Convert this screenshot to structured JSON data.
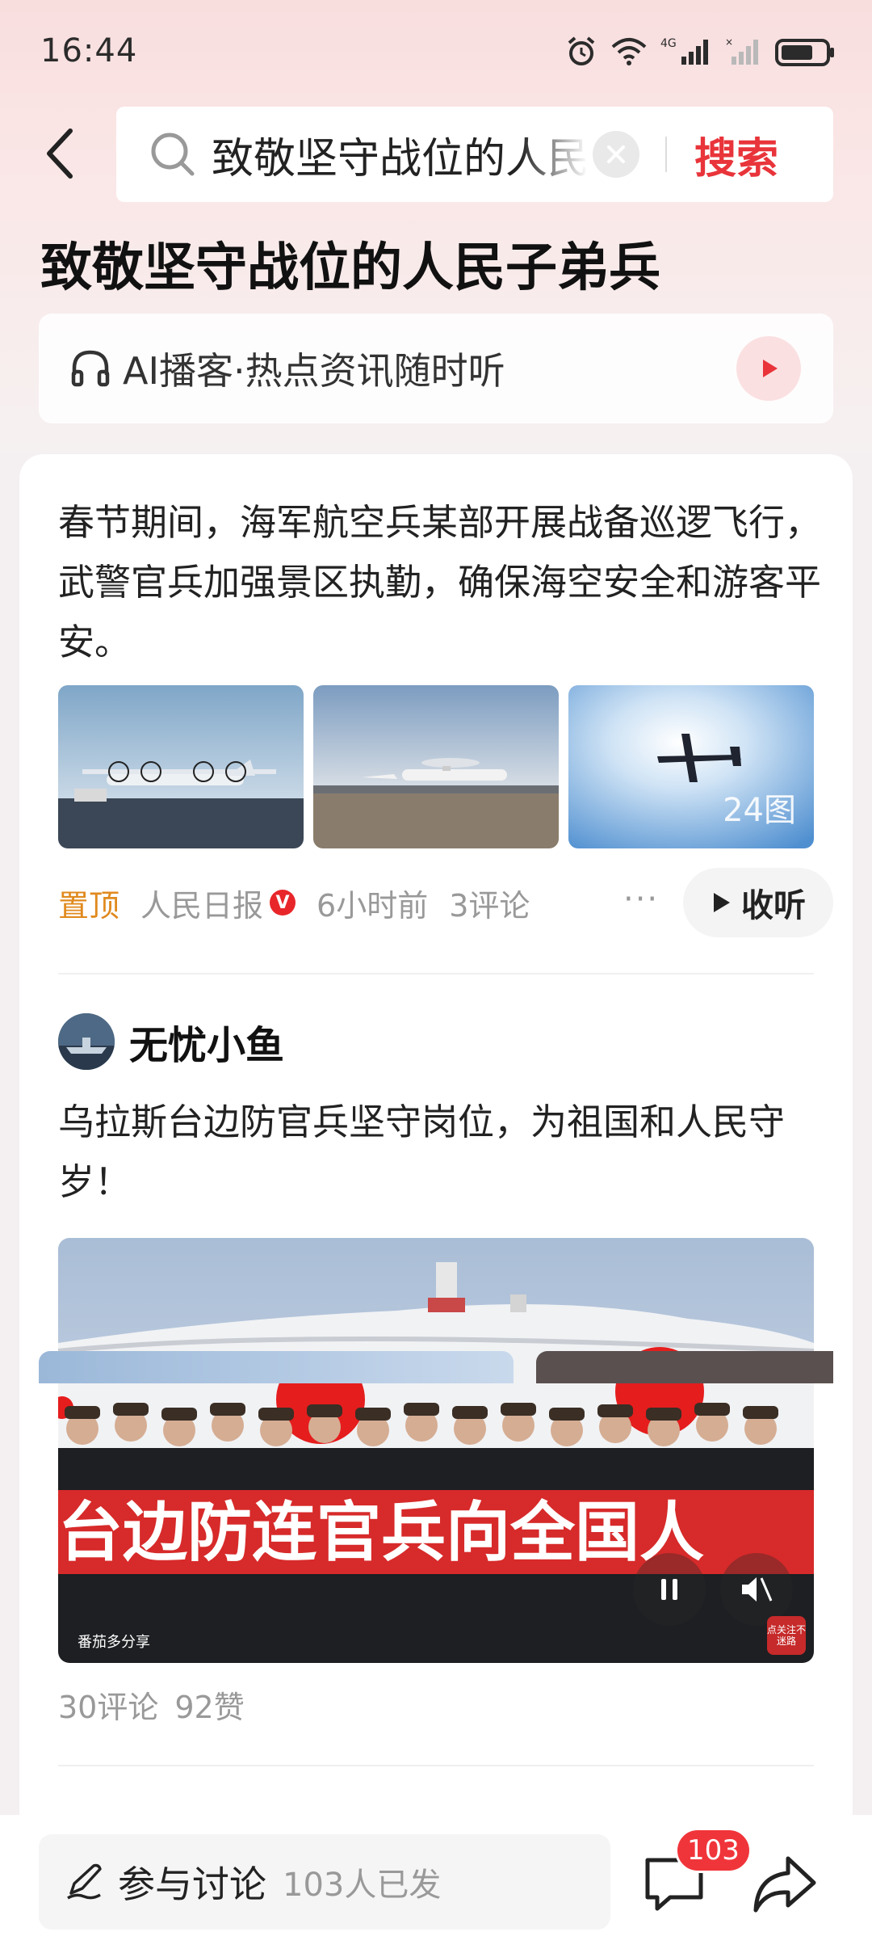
{
  "status_bar": {
    "time": "16:44"
  },
  "search": {
    "query": "致敬坚守战位的人民",
    "button_label": "搜索"
  },
  "topic": {
    "title": "致敬坚守战位的人民子弟兵"
  },
  "ai_podcast": {
    "label": "AI播客·热点资讯随时听"
  },
  "post1": {
    "text": "春节期间，海军航空兵某部开展战备巡逻飞行，武警官兵加强景区执勤，确保海空安全和游客平安。",
    "image_count": "24图",
    "pinned": "置顶",
    "source": "人民日报",
    "verified": "V",
    "time": "6小时前",
    "comments": "3评论",
    "more": "···",
    "listen": "收听"
  },
  "post2": {
    "author": "无忧小鱼",
    "text": "乌拉斯台边防官兵坚守岗位，为祖国和人民守岁！",
    "banner_text": "台边防连官兵向全国人",
    "watermark_left": "番茄多分享",
    "watermark_right": "点关注不迷路",
    "comments": "30评论",
    "likes": "92赞"
  },
  "bottom_bar": {
    "discuss_label": "参与讨论",
    "discuss_count": "103人已发",
    "comment_badge": "103"
  },
  "colors": {
    "accent": "#e8343a",
    "pinned": "#e08a1e",
    "muted": "#999999"
  }
}
